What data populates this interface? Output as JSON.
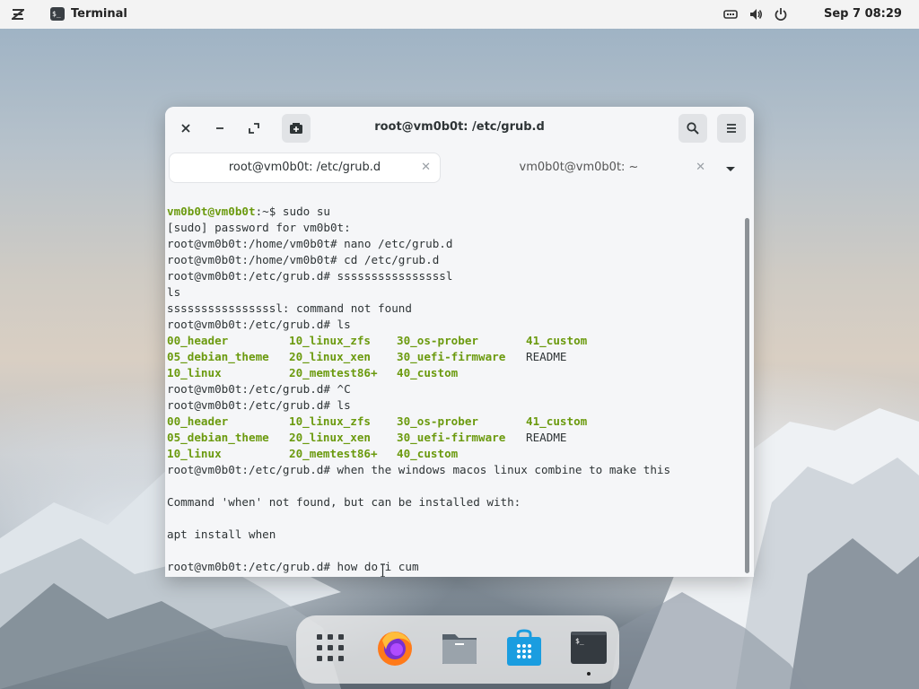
{
  "topbar": {
    "app_name": "Terminal",
    "clock": "Sep 7  08:29"
  },
  "window": {
    "title": "root@vm0b0t: /etc/grub.d",
    "tabs": [
      {
        "label": "root@vm0b0t: /etc/grub.d",
        "active": true
      },
      {
        "label": "vm0b0t@vm0b0t: ~",
        "active": false
      }
    ]
  },
  "terminal": {
    "prompt_user": "vm0b0t@vm0b0t",
    "prompt_rest": ":~$ sudo su",
    "lines": [
      "[sudo] password for vm0b0t:",
      "root@vm0b0t:/home/vm0b0t# nano /etc/grub.d",
      "root@vm0b0t:/home/vm0b0t# cd /etc/grub.d",
      "root@vm0b0t:/etc/grub.d# ssssssssssssssssl",
      "ls",
      "ssssssssssssssssl: command not found",
      "root@vm0b0t:/etc/grub.d# ls"
    ],
    "ls_output": [
      [
        "00_header",
        "10_linux_zfs",
        "30_os-prober",
        "41_custom"
      ],
      [
        "05_debian_theme",
        "20_linux_xen",
        "30_uefi-firmware",
        "README"
      ],
      [
        "10_linux",
        "20_memtest86+",
        "40_custom",
        ""
      ]
    ],
    "mid_lines": [
      "root@vm0b0t:/etc/grub.d# ^C",
      "root@vm0b0t:/etc/grub.d# ls"
    ],
    "tail_lines": [
      "root@vm0b0t:/etc/grub.d# when the windows macos linux combine to make this",
      "",
      "Command 'when' not found, but can be installed with:",
      "",
      "apt install when",
      "",
      "root@vm0b0t:/etc/grub.d# how do i cum"
    ]
  },
  "dock": {
    "apps": [
      "app-grid",
      "firefox",
      "files",
      "software",
      "terminal"
    ]
  },
  "colors": {
    "ls_green": "#6b9a0e",
    "topbar": "#f3f3f3",
    "window_bg": "#f5f6f8"
  }
}
